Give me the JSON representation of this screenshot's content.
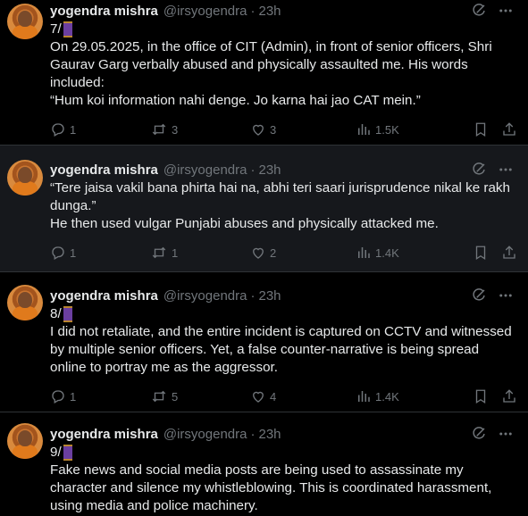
{
  "tweets": [
    {
      "name": "yogendra mishra",
      "handle": "@irsyogendra",
      "time": "23h",
      "thread_num": "7/",
      "body": "On 29.05.2025, in the office of CIT (Admin), in front of senior officers, Shri Gaurav Garg verbally abused and physically assaulted me. His words included:\n“Hum koi information nahi denge. Jo karna hai jao CAT mein.”",
      "replies": "1",
      "retweets": "3",
      "likes": "3",
      "views": "1.5K"
    },
    {
      "name": "yogendra mishra",
      "handle": "@irsyogendra",
      "time": "23h",
      "thread_num": "",
      "body": "“Tere jaisa vakil bana phirta hai na, abhi teri saari jurisprudence nikal ke rakh dunga.”\nHe then used vulgar Punjabi abuses and physically attacked me.",
      "replies": "1",
      "retweets": "1",
      "likes": "2",
      "views": "1.4K"
    },
    {
      "name": "yogendra mishra",
      "handle": "@irsyogendra",
      "time": "23h",
      "thread_num": "8/",
      "body": "I did not retaliate, and the entire incident is captured on CCTV and witnessed by multiple senior officers. Yet, a false counter-narrative is being spread online to portray me as the aggressor.",
      "replies": "1",
      "retweets": "5",
      "likes": "4",
      "views": "1.4K"
    },
    {
      "name": "yogendra mishra",
      "handle": "@irsyogendra",
      "time": "23h",
      "thread_num": "9/",
      "body": "Fake news and social media posts are being used to assassinate my character and silence my whistleblowing. This is coordinated harassment, using media and police machinery.",
      "replies": "",
      "retweets": "",
      "likes": "",
      "views": ""
    }
  ],
  "dot_separator": "·",
  "colors": {
    "background": "#000000",
    "highlight_background": "#16181c",
    "text": "#e7e9ea",
    "muted": "#71767b",
    "border": "#2f3336"
  },
  "icons": [
    "grok-icon",
    "more-icon",
    "reply-icon",
    "retweet-icon",
    "like-icon",
    "views-icon",
    "bookmark-icon",
    "share-icon",
    "thread-spool-icon"
  ]
}
